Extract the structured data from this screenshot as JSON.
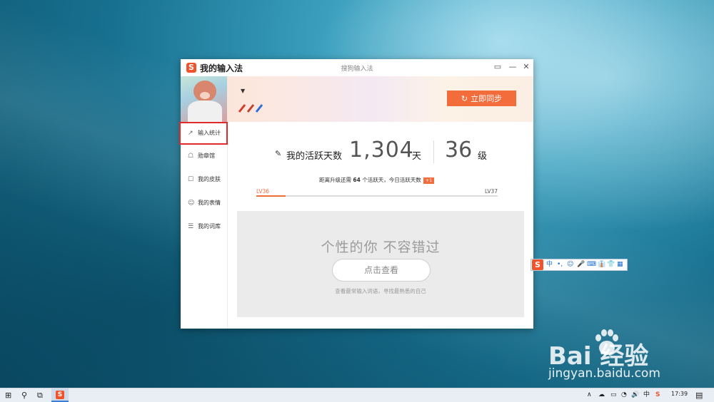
{
  "window": {
    "title": "我的输入法",
    "center_title": "搜狗输入法",
    "logo_glyph": "S",
    "controls": {
      "feedback": "▭",
      "minimize": "—",
      "close": "✕"
    }
  },
  "header": {
    "caret": "▼",
    "sync_label": "立即同步",
    "sync_icon": "↻"
  },
  "sidebar": {
    "items": [
      {
        "label": "输入统计",
        "icon": "↗"
      },
      {
        "label": "勋章馆",
        "icon": "☖"
      },
      {
        "label": "我的皮肤",
        "icon": "☐"
      },
      {
        "label": "我的表情",
        "icon": "☺"
      },
      {
        "label": "我的词库",
        "icon": "☰"
      }
    ]
  },
  "stats": {
    "days_icon": "✎",
    "days_label": "我的活跃天数",
    "days_value": "1,304",
    "days_unit": "天",
    "level_value": "36",
    "level_unit": "级",
    "note_prefix": "距离升级还需",
    "note_count": "64",
    "note_suffix": "个活跃天，今日活跃天数",
    "today_badge": "+1",
    "level_from": "LV36",
    "level_to": "LV37",
    "progress_fraction": 0.12
  },
  "promo": {
    "title": "个性的你  不容错过",
    "button": "点击查看",
    "subtitle": "查看最常输入词语，寻找最熟悉的自己"
  },
  "ime_bar": {
    "logo": "S",
    "items": [
      "中",
      "•,",
      "☺",
      "🎤",
      "⌨",
      "👔",
      "👕",
      "▦"
    ]
  },
  "watermark": {
    "logo": "Bai  经验",
    "domain": "jingyan.baidu.com"
  },
  "taskbar": {
    "start_icon": "⊞",
    "search_icon": "⚲",
    "taskview_icon": "⧉",
    "app_glyph": "S",
    "tray": [
      "∧",
      "☁",
      "▭",
      "◔",
      "🔊",
      "中",
      "S"
    ],
    "time": "17:39",
    "notify_icon": "▤"
  },
  "colors": {
    "accent": "#f36d3c",
    "highlight_border": "#e12a2a",
    "logo": "#f0542d"
  }
}
